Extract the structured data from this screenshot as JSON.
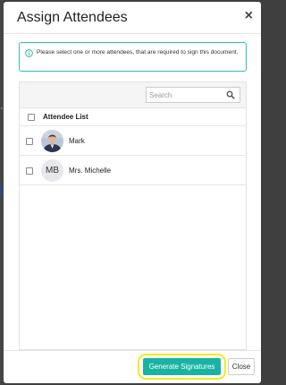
{
  "modal": {
    "title": "Assign Attendees",
    "close_glyph": "×",
    "info_icon": "info-circle-icon",
    "info_text": "Please select one or more attendees, that are required to sign this document.",
    "accent_color": "#19b3a2"
  },
  "search": {
    "placeholder": "Search",
    "value": "",
    "icon": "search-icon"
  },
  "table": {
    "header": "Attendee List",
    "rows": [
      {
        "name": "Mark",
        "avatar": "photo"
      },
      {
        "name": "Mrs. Michelle",
        "avatar": "MB"
      }
    ]
  },
  "footer": {
    "generate_label": "Generate Signatures",
    "close_label": "Close",
    "highlight_color": "#f5ea1c"
  }
}
